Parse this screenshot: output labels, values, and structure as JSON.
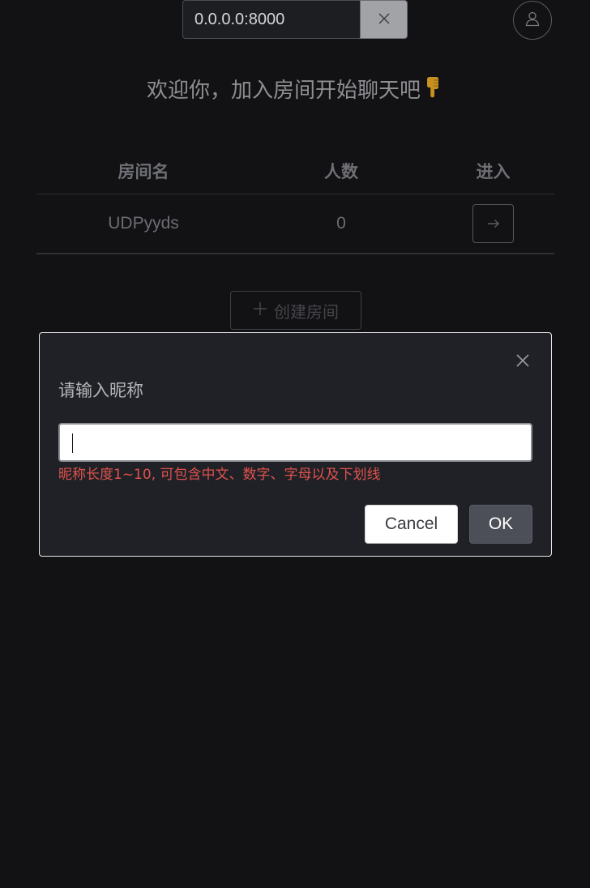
{
  "server": {
    "address": "0.0.0.0:8000",
    "clear_icon": "close-icon"
  },
  "user": {
    "avatar_icon": "user-icon"
  },
  "welcome": {
    "text": "欢迎你，加入房间开始聊天吧",
    "emoji_icon": "pointing-down-hand-icon"
  },
  "room_table": {
    "columns": [
      "房间名",
      "人数",
      "进入"
    ],
    "rows": [
      {
        "name": "UDPyyds",
        "count": "0",
        "enter_icon": "arrow-right-icon"
      }
    ]
  },
  "create_room": {
    "label": "创建房间",
    "icon": "plus-icon"
  },
  "dialog": {
    "title": "请输入昵称",
    "input_value": "",
    "hint": "昵称长度1~10, 可包含中文、数字、字母以及下划线",
    "cancel_label": "Cancel",
    "ok_label": "OK",
    "close_icon": "close-icon"
  },
  "colors": {
    "background": "#121214",
    "dialog_bg": "#202126",
    "hint_red": "#e0524e",
    "ok_bg": "#4d4f58",
    "hand_gold": "#c8911f"
  }
}
